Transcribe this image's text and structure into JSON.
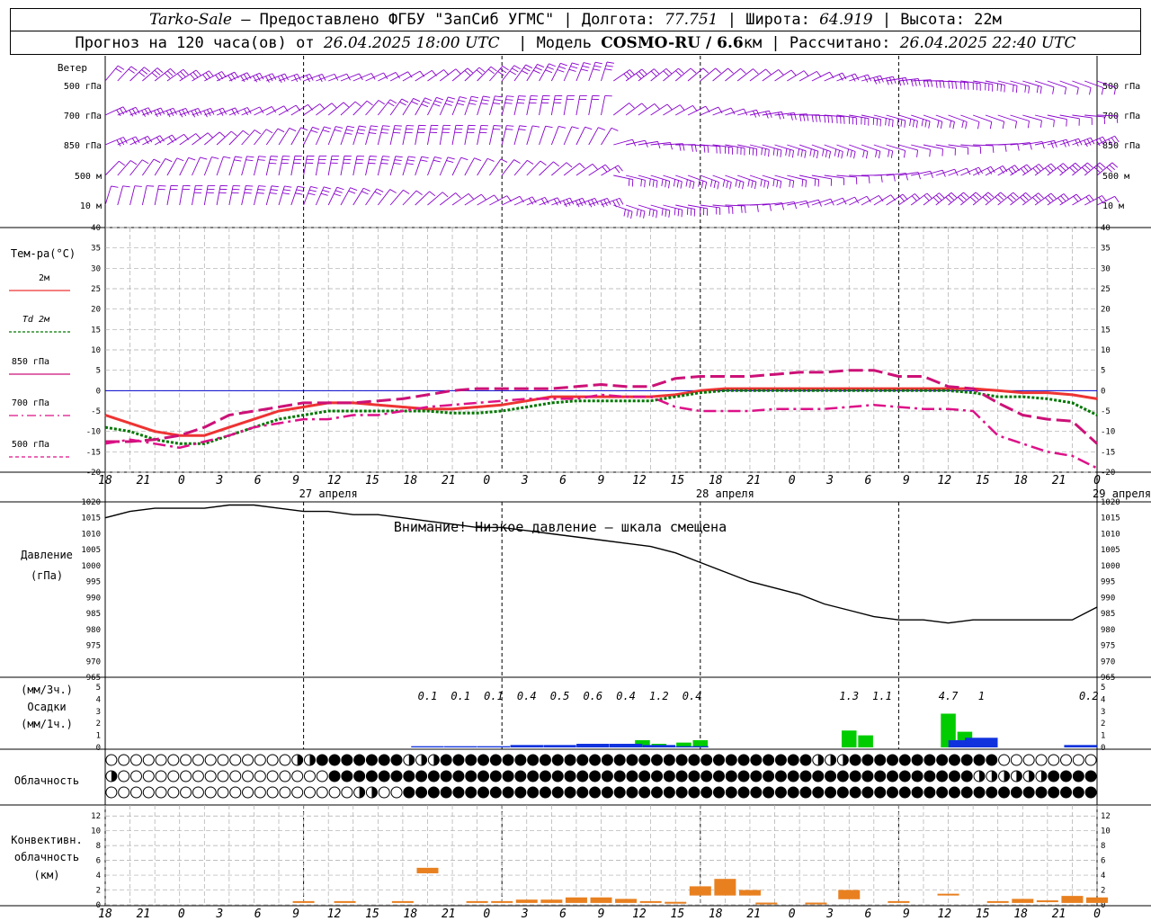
{
  "header": {
    "station": "Tarko-Sale",
    "provider": "– Предоставлено ФГБУ \"ЗапСиб УГМС\" | Долгота: ",
    "lon": "77.751",
    "lat_label": " | Широта: ",
    "lat": "64.919",
    "alt_label": " | Высота: ",
    "alt": "22м",
    "line2_a": "Прогноз на 120 часа(ов) от ",
    "start": "26.04.2025 18:00 UTC",
    "line2_b": "  | Модель ",
    "model": "COSMO-RU / 6.6",
    "model_unit": "км | Рассчитано: ",
    "computed": "26.04.2025 22:40 UTC"
  },
  "labels": {
    "wind_title": "Ветер",
    "wind_levels": [
      "500 гПа",
      "700 гПа",
      "850 гПа",
      "500 м",
      "10  м"
    ],
    "temp_title": "Тем-ра(°С)",
    "legend": [
      "2м",
      "Td 2м",
      "850 гПа",
      "700 гПа",
      "500 гПа"
    ],
    "pressure_title": "Давление",
    "pressure_unit": "(гПа)",
    "pressure_note": "Внимание! Низкое давление – шкала смещена",
    "precip_unit1": "(мм/3ч.)",
    "precip_title": "Осадки",
    "precip_unit2": "(мм/1ч.)",
    "cloud_title": "Облачность",
    "conv_title1": "Конвективн.",
    "conv_title2": "облачность",
    "conv_unit": "(км)",
    "hour_ticks": [
      "18",
      "21",
      "0",
      "3",
      "6",
      "9",
      "12",
      "15",
      "18",
      "21",
      "0",
      "3",
      "6",
      "9",
      "12",
      "15",
      "18",
      "21",
      "0",
      "3",
      "6",
      "9",
      "12",
      "15",
      "18",
      "21",
      "0"
    ],
    "days": [
      "27 апреля",
      "28 апреля",
      "29 апреля"
    ]
  },
  "colors": {
    "t2m": "#ee3333",
    "td2m": "#007700",
    "t850": "#cc1177",
    "t700": "#dd1188",
    "t500": "#dd1188",
    "wind": "#8800cc",
    "pressure": "#000000",
    "precip3h": "#00cc00",
    "precip1h": "#1133dd",
    "conv": "#e88020",
    "zero": "#0000cc",
    "grid": "#aaaaaa"
  },
  "chart_data": [
    {
      "type": "line",
      "title": "Тем-ра(°С)",
      "x_hours": [
        0,
        3,
        6,
        9,
        12,
        15,
        18,
        21,
        24,
        27,
        30,
        33,
        36,
        39,
        42,
        45,
        48,
        51,
        54,
        57,
        60,
        63,
        66,
        69,
        72,
        75,
        78,
        81,
        84,
        87,
        90,
        93,
        96,
        99,
        102,
        105,
        108,
        111,
        114,
        117,
        120
      ],
      "ylim": [
        -20,
        40
      ],
      "series": [
        {
          "name": "2м",
          "values": [
            -6,
            -8,
            -10,
            -11,
            -11,
            -9,
            -7,
            -5,
            -4,
            -3,
            -3,
            -3.5,
            -4,
            -4.5,
            -4.5,
            -4,
            -3.5,
            -2.5,
            -1.5,
            -1.5,
            -1.5,
            -1.5,
            -1.5,
            -1,
            0,
            0.5,
            0.5,
            0.5,
            0.5,
            0.5,
            0.5,
            0.5,
            0.5,
            0.5,
            0.5,
            0.5,
            0,
            -0.5,
            -0.5,
            -1,
            -2
          ]
        },
        {
          "name": "Td 2м",
          "values": [
            -9,
            -10,
            -12,
            -13,
            -13,
            -11,
            -9,
            -7,
            -6,
            -5,
            -5,
            -5,
            -5,
            -5,
            -5.5,
            -5.5,
            -5,
            -4,
            -3,
            -2.5,
            -2.5,
            -2.5,
            -2.5,
            -1.5,
            -0.5,
            0,
            0,
            0,
            0,
            0,
            0,
            0,
            0,
            0,
            0,
            -0.5,
            -1.5,
            -1.5,
            -2,
            -3,
            -6
          ]
        },
        {
          "name": "850 гПа",
          "values": [
            -12.5,
            -12.5,
            -12,
            -11,
            -9,
            -6,
            -5,
            -4,
            -3,
            -3,
            -3,
            -2.5,
            -2,
            -1,
            0,
            0.5,
            0.5,
            0.5,
            0.5,
            1,
            1.5,
            1,
            1,
            3,
            3.5,
            3.5,
            3.5,
            4,
            4.5,
            4.5,
            5,
            5,
            3.5,
            3.5,
            1,
            0.5,
            -3,
            -6,
            -7,
            -7.5,
            -13
          ]
        },
        {
          "name": "700 гПа",
          "values": [
            -13,
            -12,
            -13,
            -14,
            -12.5,
            -11,
            -9,
            -8,
            -7,
            -7,
            -6,
            -6,
            -5,
            -4,
            -3.5,
            -3,
            -2.5,
            -2,
            -2,
            -2,
            -1,
            -1.5,
            -1.5,
            -4,
            -5,
            -5,
            -5,
            -4.5,
            -4.5,
            -4.5,
            -4,
            -3.5,
            -4,
            -4.5,
            -4.5,
            -5,
            -11,
            -13,
            -15,
            -16,
            -19
          ]
        },
        {
          "name": "500 гПа",
          "values": [
            null,
            null,
            null,
            null,
            null,
            null,
            null,
            null,
            null,
            null,
            null,
            null,
            null,
            null,
            null,
            null,
            null,
            null,
            null,
            null,
            null,
            null,
            null,
            null,
            -19,
            null,
            -19,
            null,
            -19,
            null,
            null,
            null,
            null,
            null,
            null,
            null,
            null,
            null,
            null,
            null,
            null
          ]
        }
      ]
    },
    {
      "type": "line",
      "title": "Давление",
      "x_hours": [
        0,
        3,
        6,
        9,
        12,
        15,
        18,
        21,
        24,
        27,
        30,
        33,
        36,
        39,
        42,
        45,
        48,
        51,
        54,
        57,
        60,
        63,
        66,
        69,
        72,
        75,
        78,
        81,
        84,
        87,
        90,
        93,
        96,
        99,
        102,
        105,
        108,
        111,
        114,
        117,
        120
      ],
      "ylim": [
        965,
        1020
      ],
      "series": [
        {
          "name": "Давление",
          "values": [
            1015,
            1017,
            1018,
            1018,
            1018,
            1019,
            1019,
            1018,
            1017,
            1017,
            1016,
            1016,
            1015,
            1014,
            1013,
            1012,
            1012,
            1011,
            1010,
            1009,
            1008,
            1007,
            1006,
            1004,
            1001,
            998,
            995,
            993,
            991,
            988,
            986,
            984,
            983,
            983,
            982,
            983,
            983,
            983,
            983,
            983,
            987
          ]
        }
      ]
    },
    {
      "type": "bar",
      "title": "Осадки",
      "series": [
        {
          "name": "мм/3ч.",
          "x_hours": [
            65,
            67,
            70,
            72,
            90,
            92,
            102,
            104
          ],
          "values": [
            0.6,
            0.3,
            0.4,
            0.6,
            1.4,
            1.0,
            2.8,
            1.3
          ]
        },
        {
          "name": "мм/1ч.",
          "x_hours": [
            39,
            43,
            47,
            51,
            55,
            59,
            63,
            67,
            71,
            104,
            106,
            118
          ],
          "values": [
            0.1,
            0.1,
            0.1,
            0.2,
            0.2,
            0.3,
            0.3,
            0.2,
            0.1,
            0.6,
            0.8,
            0.2
          ]
        }
      ],
      "labels": [
        {
          "x": 39,
          "text": "0.1"
        },
        {
          "x": 43,
          "text": "0.1"
        },
        {
          "x": 47,
          "text": "0.1"
        },
        {
          "x": 51,
          "text": "0.4"
        },
        {
          "x": 55,
          "text": "0.5"
        },
        {
          "x": 59,
          "text": "0.6"
        },
        {
          "x": 63,
          "text": "0.4"
        },
        {
          "x": 67,
          "text": "1.2"
        },
        {
          "x": 71,
          "text": "0.4"
        },
        {
          "x": 90,
          "text": "1.3"
        },
        {
          "x": 94,
          "text": "1.1"
        },
        {
          "x": 102,
          "text": "4.7"
        },
        {
          "x": 106,
          "text": "1"
        },
        {
          "x": 119,
          "text": "0.2"
        }
      ],
      "ylim": [
        0,
        5
      ]
    },
    {
      "type": "heatmap",
      "title": "Облачность",
      "rows": [
        "00000000000000000001112222222222333222222222222222222222222222222222222222233332222222222222222300000000000",
        "1000000000000000000000002222222222222222222222222222222222222222222222222222222222222222222222233333333222222",
        "0000000000000000000000000001100022222222222222222222222222222222222222222222222222222222222222222222222222222"
      ],
      "legend_levels": [
        "0 = clear",
        "1 = partial",
        "2 = overcast",
        "3 = mixed"
      ]
    },
    {
      "type": "bar",
      "title": "Конвективн. облачность",
      "x_hours": [
        24,
        29,
        36,
        39,
        45,
        48,
        51,
        54,
        57,
        60,
        63,
        66,
        69,
        72,
        75,
        78,
        80,
        86,
        90,
        96,
        102,
        108,
        111,
        114,
        117,
        120
      ],
      "tops": [
        0.5,
        0.5,
        0.5,
        5,
        0.5,
        0.5,
        0.7,
        0.7,
        1,
        1,
        0.8,
        0.5,
        0.4,
        2.5,
        3.5,
        2,
        0.3,
        0.3,
        2,
        0.5,
        1.5,
        0.5,
        0.8,
        0.6,
        1.2,
        1
      ],
      "bottoms": [
        0.5,
        0.5,
        0.5,
        4.5,
        0.5,
        0.5,
        0.5,
        0.5,
        0.5,
        0.5,
        0.5,
        0.5,
        0.4,
        1.5,
        1.5,
        1.5,
        0.3,
        0.3,
        1,
        0.5,
        1.5,
        0.5,
        0.5,
        0.6,
        0.5,
        0.5
      ],
      "ylim": [
        0,
        13
      ]
    }
  ]
}
